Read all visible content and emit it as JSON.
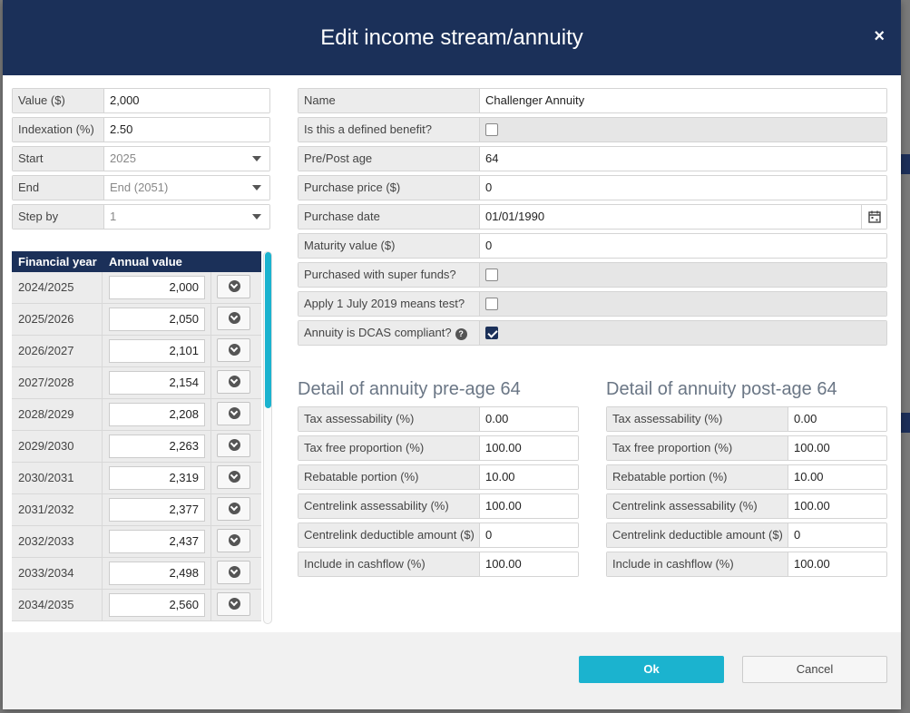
{
  "modal": {
    "title": "Edit income stream/annuity",
    "close_icon": "×"
  },
  "left_fields": {
    "value": {
      "label": "Value ($)",
      "value": "2,000"
    },
    "indexation": {
      "label": "Indexation (%)",
      "value": "2.50"
    },
    "start": {
      "label": "Start",
      "value": "2025"
    },
    "end": {
      "label": "End",
      "value": "End (2051)"
    },
    "step_by": {
      "label": "Step by",
      "value": "1"
    }
  },
  "grid": {
    "headers": [
      "Financial year",
      "Annual value"
    ],
    "rows": [
      {
        "year": "2024/2025",
        "value": "2,000"
      },
      {
        "year": "2025/2026",
        "value": "2,050"
      },
      {
        "year": "2026/2027",
        "value": "2,101"
      },
      {
        "year": "2027/2028",
        "value": "2,154"
      },
      {
        "year": "2028/2029",
        "value": "2,208"
      },
      {
        "year": "2029/2030",
        "value": "2,263"
      },
      {
        "year": "2030/2031",
        "value": "2,319"
      },
      {
        "year": "2031/2032",
        "value": "2,377"
      },
      {
        "year": "2032/2033",
        "value": "2,437"
      },
      {
        "year": "2033/2034",
        "value": "2,498"
      },
      {
        "year": "2034/2035",
        "value": "2,560"
      }
    ]
  },
  "right_fields": {
    "name": {
      "label": "Name",
      "value": "Challenger Annuity"
    },
    "defined_benefit": {
      "label": "Is this a defined benefit?",
      "checked": false
    },
    "pre_post_age": {
      "label": "Pre/Post age",
      "value": "64"
    },
    "purchase_price": {
      "label": "Purchase price ($)",
      "value": "0"
    },
    "purchase_date": {
      "label": "Purchase date",
      "value": "01/01/1990"
    },
    "maturity_value": {
      "label": "Maturity value ($)",
      "value": "0"
    },
    "super_funds": {
      "label": "Purchased with super funds?",
      "checked": false
    },
    "means_test": {
      "label": "Apply 1 July 2019 means test?",
      "checked": false
    },
    "dcas": {
      "label": "Annuity is DCAS compliant?",
      "help": "?",
      "checked": true
    }
  },
  "pre_section": {
    "title": "Detail of annuity pre-age 64",
    "fields": [
      {
        "label": "Tax assessability (%)",
        "value": "0.00"
      },
      {
        "label": "Tax free proportion (%)",
        "value": "100.00"
      },
      {
        "label": "Rebatable portion (%)",
        "value": "10.00"
      },
      {
        "label": "Centrelink assessability (%)",
        "value": "100.00"
      },
      {
        "label": "Centrelink deductible amount ($)",
        "value": "0"
      },
      {
        "label": "Include in cashflow (%)",
        "value": "100.00"
      }
    ]
  },
  "post_section": {
    "title": "Detail of annuity post-age 64",
    "fields": [
      {
        "label": "Tax assessability (%)",
        "value": "0.00"
      },
      {
        "label": "Tax free proportion (%)",
        "value": "100.00"
      },
      {
        "label": "Rebatable portion (%)",
        "value": "10.00"
      },
      {
        "label": "Centrelink assessability (%)",
        "value": "100.00"
      },
      {
        "label": "Centrelink deductible amount ($)",
        "value": "0"
      },
      {
        "label": "Include in cashflow (%)",
        "value": "100.00"
      }
    ]
  },
  "footer": {
    "ok_label": "Ok",
    "cancel_label": "Cancel"
  },
  "colors": {
    "header_bg": "#1b3059",
    "accent": "#1bb3cf"
  }
}
